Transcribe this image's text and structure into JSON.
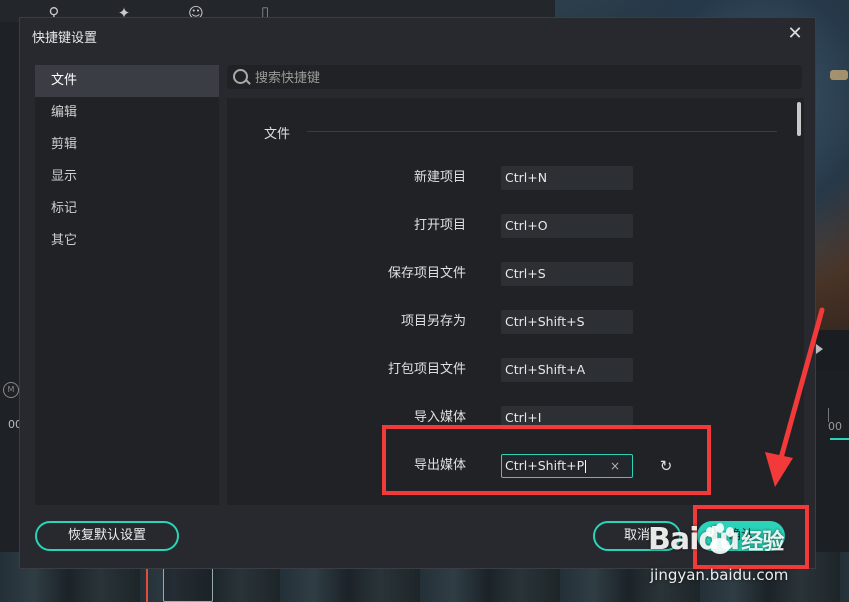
{
  "dialog": {
    "title": "快捷键设置",
    "close_glyph": "✕"
  },
  "categories": [
    {
      "label": "文件",
      "active": true
    },
    {
      "label": "编辑",
      "active": false
    },
    {
      "label": "剪辑",
      "active": false
    },
    {
      "label": "显示",
      "active": false
    },
    {
      "label": "标记",
      "active": false
    },
    {
      "label": "其它",
      "active": false
    }
  ],
  "search": {
    "placeholder": "搜索快捷键",
    "icon": "search-icon"
  },
  "section": {
    "title": "文件"
  },
  "shortcuts": [
    {
      "label": "新建项目",
      "keys": "Ctrl+N"
    },
    {
      "label": "打开项目",
      "keys": "Ctrl+O"
    },
    {
      "label": "保存项目文件",
      "keys": "Ctrl+S"
    },
    {
      "label": "项目另存为",
      "keys": "Ctrl+Shift+S"
    },
    {
      "label": "打包项目文件",
      "keys": "Ctrl+Shift+A"
    },
    {
      "label": "导入媒体",
      "keys": "Ctrl+I"
    },
    {
      "label": "导出媒体",
      "keys": "Ctrl+Shift+P",
      "editing": true
    }
  ],
  "editing_row": {
    "clear_glyph": "×",
    "reset_icon": "reset-icon",
    "reset_glyph": "↻"
  },
  "footer": {
    "restore_default_label": "恢复默认设置",
    "cancel_label": "取消",
    "confirm_label": "确认"
  },
  "background": {
    "timestamp": "00:",
    "ruler_label": "00"
  },
  "watermark": {
    "logo_text": "Baidu",
    "logo_suffix": "经验",
    "url": "jingyan.baidu.com"
  },
  "colors": {
    "accent": "#2bd3b8",
    "annotation": "#f23a3a",
    "dialog_bg": "#27292e",
    "panel_bg": "#202226"
  }
}
